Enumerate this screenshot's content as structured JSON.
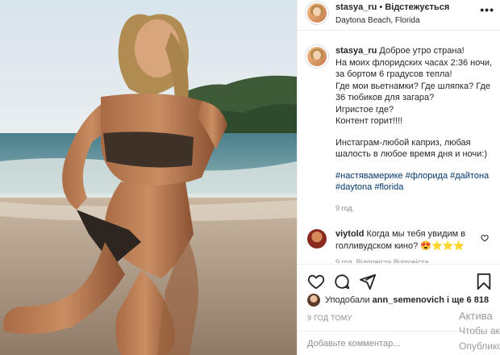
{
  "post": {
    "username": "stasya_ru",
    "separator": " • ",
    "follow_label": "Відстежується",
    "location": "Daytona Beach, Florida",
    "more_icon": "more-horizontal-icon"
  },
  "caption": {
    "username": "stasya_ru",
    "paragraph1": "Доброе утро страна!\nНа моих флоридских часах 2:36 ночи, за бортом 6 градусов тепла!\nГде мои вьетнамки? Где шляпка? Где 36 тюбиков для загара?\nИгристое где?\nКонтент горит!!!!",
    "paragraph2": "Инстаграм-любой каприз, любая шалость в любое время дня и ночи:)",
    "hashtags": "#настявамерике #флорида #дайтона #daytona #florida",
    "time": "9 год."
  },
  "comment": {
    "username": "viytold",
    "text": "Когда мы тебя увидим в голливудском кино? 😍⭐⭐⭐",
    "meta": "9 год.   Відповісти   Відповісти"
  },
  "actions": {
    "icons": [
      "heart-icon",
      "comment-icon",
      "share-icon",
      "bookmark-icon"
    ]
  },
  "likes": {
    "prefix": "Уподобали ",
    "user": "ann_semenovich",
    "suffix": " і ще 6 818"
  },
  "post_time": "9 ГОД ТОМУ",
  "add_comment": {
    "placeholder": "Добавьте комментар..."
  },
  "watermark": {
    "line1": "Актива",
    "line2": "Чтобы ак",
    "line3": "Опубликовать"
  },
  "colors": {
    "hashtag": "#00376b",
    "muted": "#8e8e8e",
    "text": "#262626"
  }
}
